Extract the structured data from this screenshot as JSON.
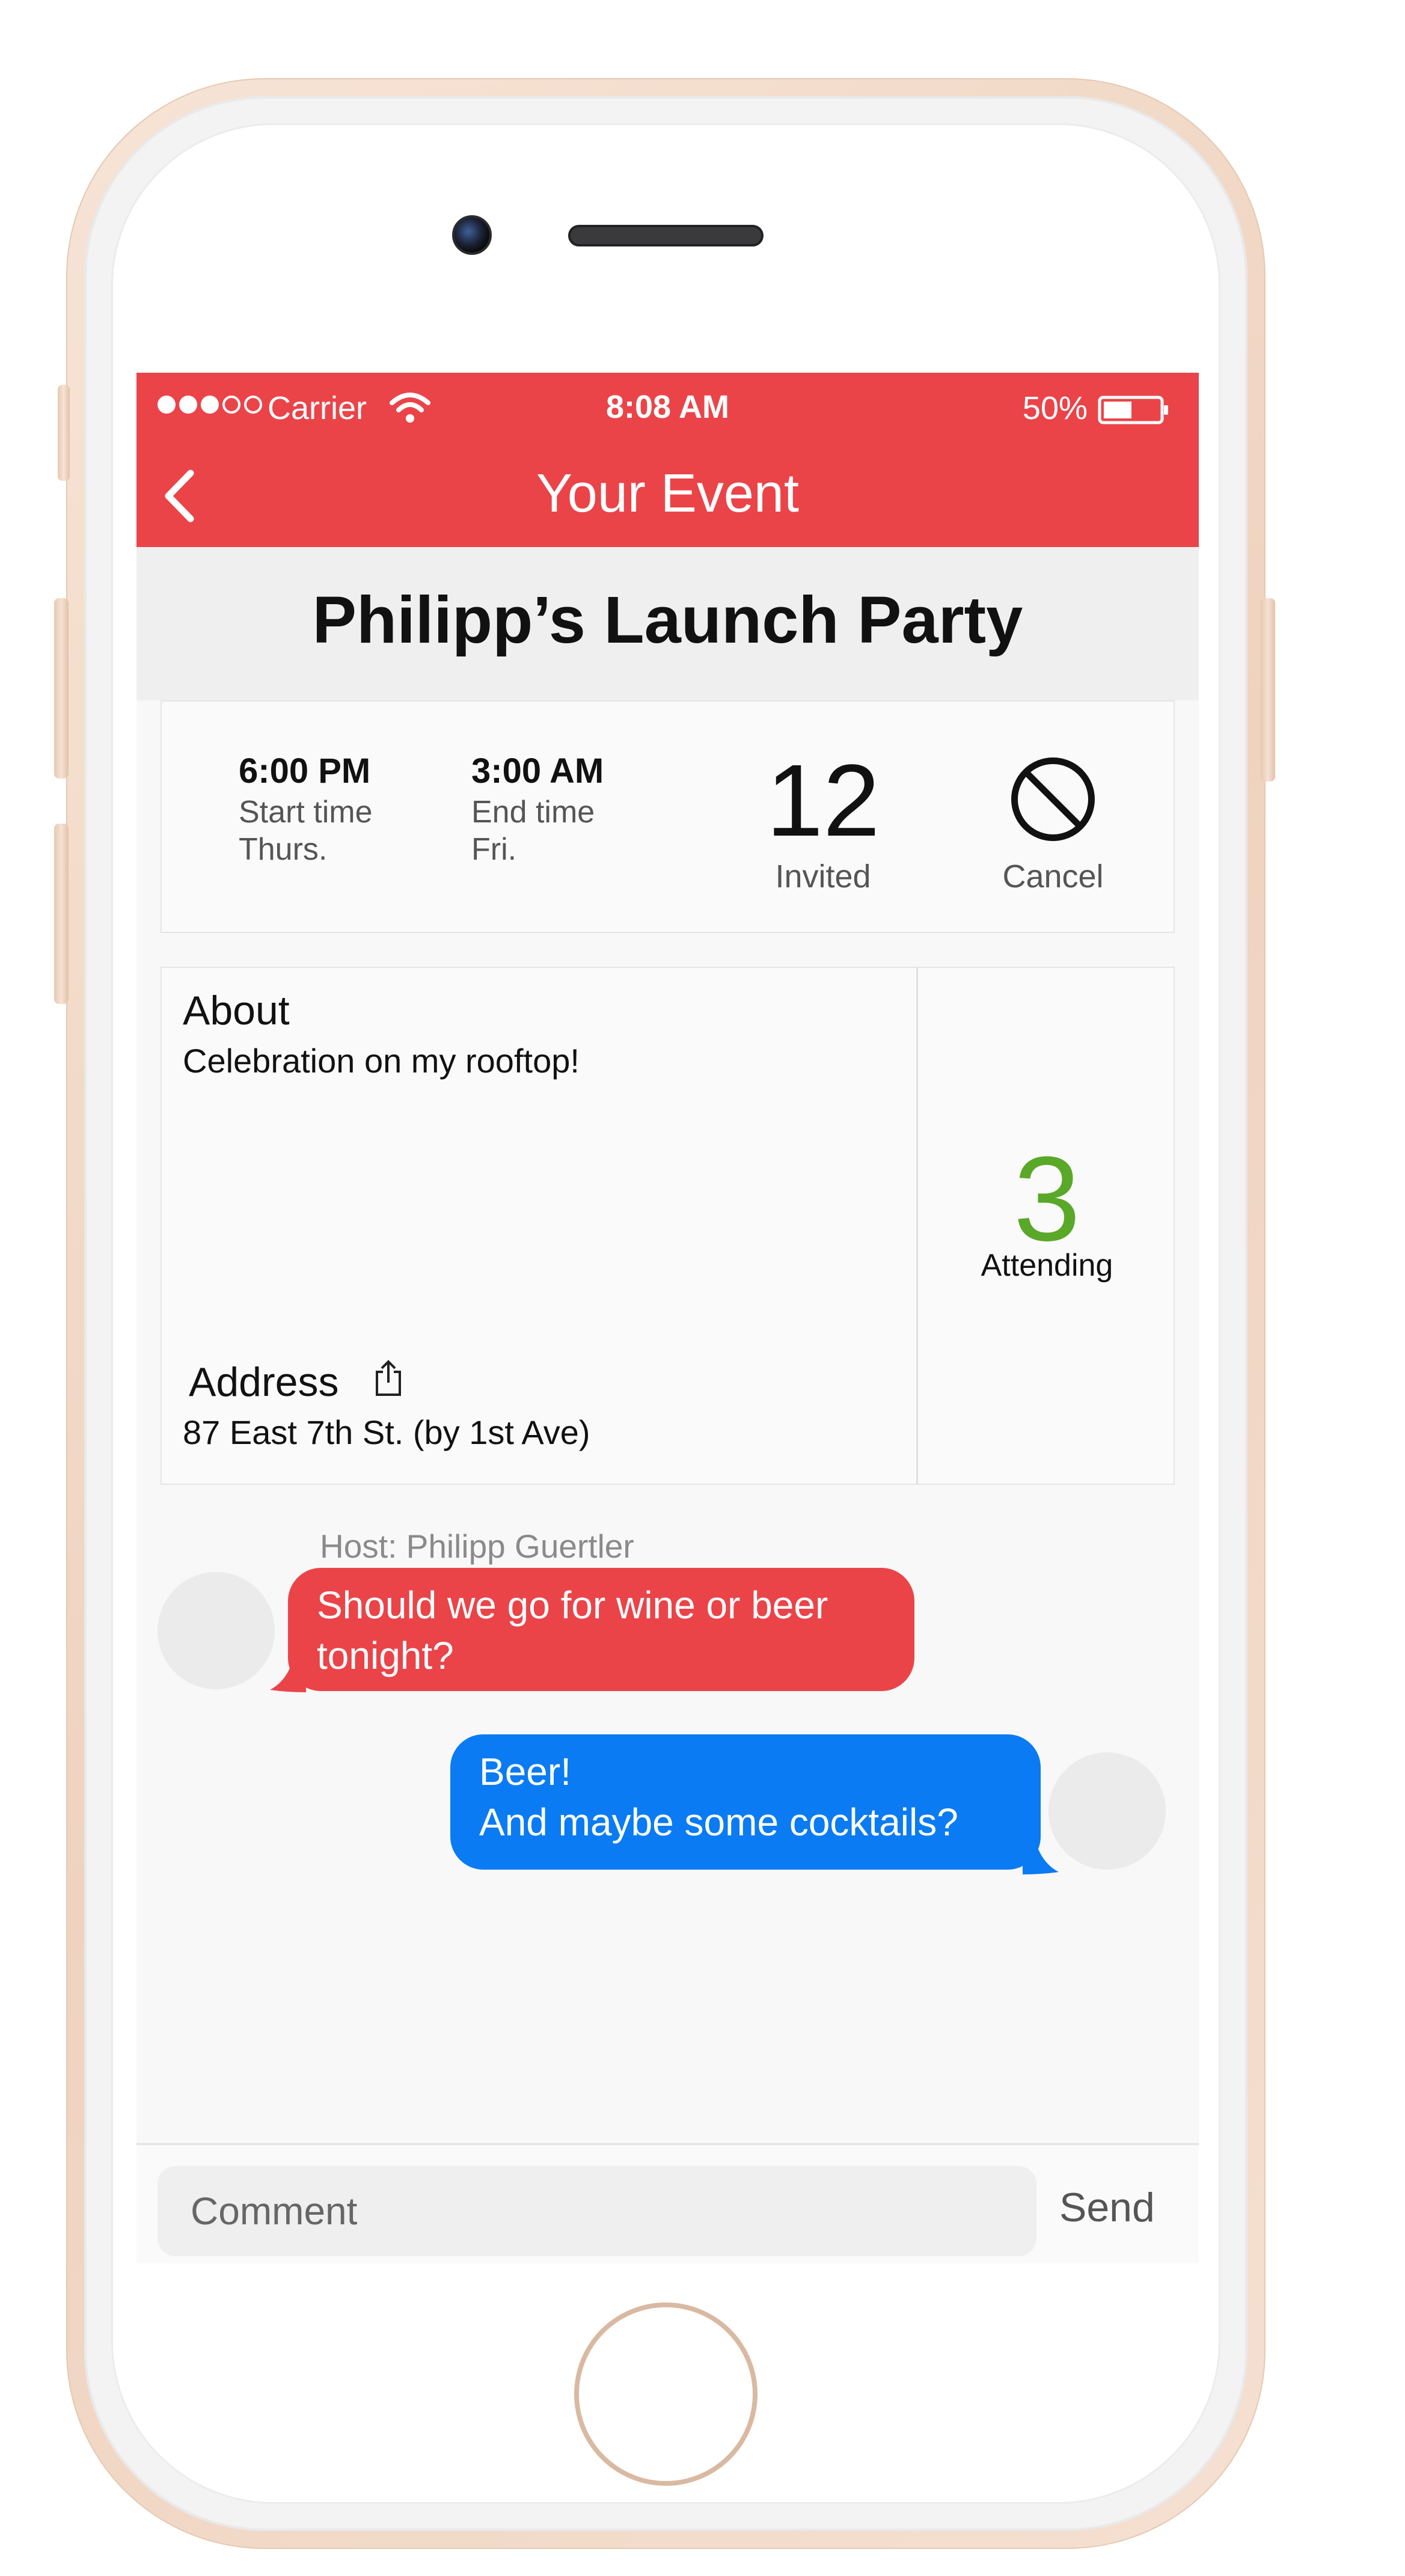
{
  "status_bar": {
    "carrier": "Carrier",
    "time": "8:08 AM",
    "battery": "50%",
    "signal_bars_filled": 3,
    "signal_bars_total": 5
  },
  "nav": {
    "title": "Your Event",
    "back_icon": "chevron-left-icon"
  },
  "event": {
    "title": "Philipp’s Launch Party",
    "start": {
      "time": "6:00 PM",
      "label": "Start time",
      "day": "Thurs."
    },
    "end": {
      "time": "3:00 AM",
      "label": "End time",
      "day": "Fri."
    },
    "invited": {
      "count": "12",
      "label": "Invited"
    },
    "cancel": {
      "label": "Cancel",
      "icon": "prohibited-icon"
    },
    "about": {
      "heading": "About",
      "text": "Celebration on my rooftop!"
    },
    "address": {
      "heading": "Address",
      "text": "87 East 7th St. (by 1st Ave)",
      "icon": "share-icon"
    },
    "attending": {
      "count": "3",
      "label": "Attending"
    }
  },
  "chat": {
    "host_label": "Host: Philipp Guertler",
    "messages": [
      {
        "side": "left",
        "text": "Should we go for wine or beer tonight?"
      },
      {
        "side": "right",
        "text": "Beer!\nAnd maybe some cocktails?"
      }
    ]
  },
  "compose": {
    "placeholder": "Comment",
    "send_label": "Send"
  },
  "colors": {
    "accent": "#ea4449",
    "outgoing_bubble": "#0a7bf3",
    "attending": "#5aa828",
    "phone_frame": "#f2dccb"
  }
}
